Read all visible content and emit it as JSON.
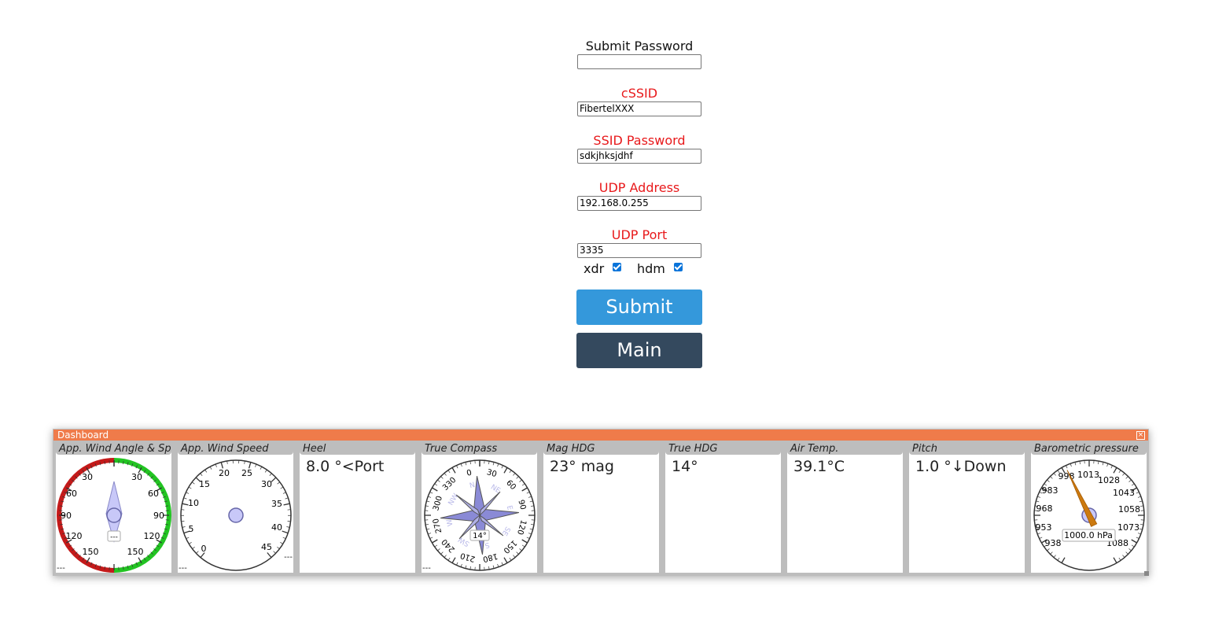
{
  "form": {
    "submit_password_label": "Submit Password",
    "submit_password_value": "",
    "cssid_label": "cSSID",
    "cssid_value": "FibertelXXX",
    "ssid_password_label": "SSID Password",
    "ssid_password_value": "sdkjhksjdhf",
    "udp_address_label": "UDP Address",
    "udp_address_value": "192.168.0.255",
    "udp_port_label": "UDP Port",
    "udp_port_value": "3335",
    "xdr_label": "xdr",
    "xdr_checked": true,
    "hdm_label": "hdm",
    "hdm_checked": true,
    "submit_button": "Submit",
    "main_button": "Main",
    "colors": {
      "submit": "#3498db",
      "main": "#34495e",
      "label_red": "#e8191b"
    }
  },
  "dashboard": {
    "title": "Dashboard",
    "title_color": "#ef7b4a",
    "widgets": [
      {
        "title": "App. Wind Angle & Speed",
        "footer": "---",
        "center_label": "---",
        "ticks": [
          "30",
          "30",
          "60",
          "60",
          "90",
          "90",
          "120",
          "120",
          "150",
          "150"
        ]
      },
      {
        "title": "App. Wind Speed",
        "footer_left": "---",
        "footer_right": "---",
        "ticks": [
          "0",
          "5",
          "10",
          "15",
          "20",
          "25",
          "30",
          "35",
          "40",
          "45"
        ]
      },
      {
        "title": "Heel",
        "value": "8.0 °<Port"
      },
      {
        "title": "True Compass",
        "footer": "---",
        "heading_label": "14°",
        "heading": 14,
        "ticks": [
          "0",
          "30",
          "60",
          "90",
          "120",
          "150",
          "180",
          "210",
          "240",
          "270",
          "300",
          "330"
        ],
        "cardinals": [
          "N",
          "NE",
          "E",
          "SE",
          "S",
          "SW",
          "W",
          "NW"
        ]
      },
      {
        "title": "Mag HDG",
        "value": "23° mag"
      },
      {
        "title": "True HDG",
        "value": "14°"
      },
      {
        "title": "Air Temp.",
        "value": "39.1°C"
      },
      {
        "title": "Pitch",
        "value": "1.0 °↓Down"
      },
      {
        "title": "Barometric pressure",
        "value_label": "1000.0 hPa",
        "value": 1000.0,
        "ticks": [
          "938",
          "953",
          "968",
          "983",
          "998",
          "1013",
          "1028",
          "1043",
          "1058",
          "1073",
          "1088"
        ]
      }
    ]
  }
}
